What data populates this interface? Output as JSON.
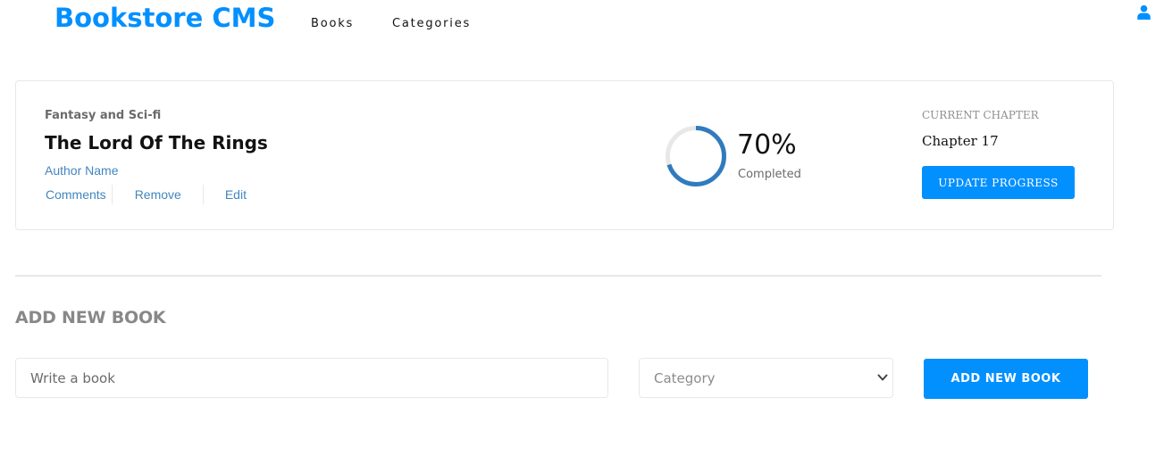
{
  "header": {
    "brand": "Bookstore CMS",
    "nav": [
      {
        "label": "Books"
      },
      {
        "label": "Categories"
      }
    ],
    "user_icon": "user-icon"
  },
  "book": {
    "category": "Fantasy and Sci-fi",
    "title": "The Lord Of The Rings",
    "author": "Author Name",
    "actions": [
      {
        "label": "Comments"
      },
      {
        "label": "Remove"
      },
      {
        "label": "Edit"
      }
    ],
    "progress": {
      "percent": 70,
      "percent_label": "70%",
      "completed_label": "Completed"
    },
    "current_chapter_label": "CURRENT CHAPTER",
    "chapter": "Chapter 17",
    "update_button": "UPDATE PROGRESS"
  },
  "form": {
    "title": "ADD NEW BOOK",
    "book_placeholder": "Write a book",
    "category_selected": "Category",
    "submit_label": "ADD NEW BOOK"
  },
  "colors": {
    "accent": "#0290ff",
    "link": "#4386bf",
    "progress": "#307bbe",
    "progress_track": "#e8e8e8"
  }
}
